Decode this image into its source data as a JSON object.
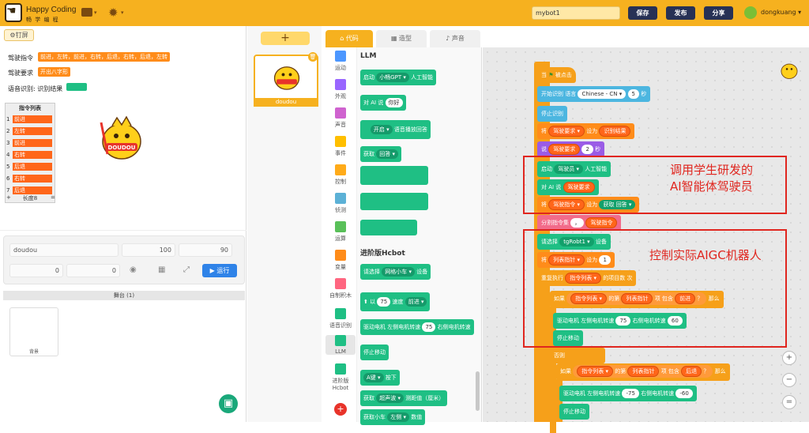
{
  "app": {
    "brand_en": "Happy Coding",
    "brand_cn": "畅 学 编 程",
    "project_name": "mybot1",
    "save": "保存",
    "publish": "发布",
    "share": "分享",
    "username": "dongkuang"
  },
  "left": {
    "pin": "钉屏",
    "vars": [
      {
        "label": "驾驶指令",
        "value": "前进，左转，前进，右转，后退，右转，后退，左转"
      },
      {
        "label": "驾驶要求",
        "value": "开出八字形"
      },
      {
        "label": "语音识别: 识别结果",
        "value": ""
      }
    ],
    "list": {
      "title": "指令列表",
      "items": [
        "前进",
        "左转",
        "前进",
        "右转",
        "后退",
        "右转",
        "后退"
      ],
      "plus": "+",
      "length": "长度8",
      "eq": "="
    },
    "mascot_text": "DOUDOU",
    "sprite": {
      "name": "doudou",
      "x": "100",
      "y": "90",
      "size": "0",
      "direction": "0",
      "run": "运行"
    },
    "backdrop": {
      "title": "舞台",
      "count": "(1)",
      "label": "背景"
    }
  },
  "sprites": {
    "add": "+",
    "card": "doudou"
  },
  "tabs": [
    "代码",
    "造型",
    "声音"
  ],
  "categories": [
    "运动",
    "外观",
    "声音",
    "事件",
    "控制",
    "侦测",
    "运算",
    "变量",
    "自制积木",
    "语音识别",
    "LLM",
    "进阶版Hcbot"
  ],
  "category_colors": [
    "#4c97ff",
    "#9966ff",
    "#cf63cf",
    "#ffbf00",
    "#ffab19",
    "#5cb1d6",
    "#59c059",
    "#ff8c1a",
    "#ff6680",
    "#1fbf84",
    "#1fbf84",
    "#1fbf84"
  ],
  "palette": {
    "llm_title": "LLM",
    "b1": [
      "启动",
      "小畅GPT",
      "人工智能"
    ],
    "b2": [
      "对 AI 说",
      "你好"
    ],
    "b3": [
      "开启",
      "语音播放回答"
    ],
    "b4": [
      "获取",
      "回答"
    ],
    "hcbot_title": "进阶版Hcbot",
    "b5": [
      "请选择",
      "网格小车",
      "设备"
    ],
    "b6": [
      "以",
      "75",
      "速度",
      "前进"
    ],
    "b7": [
      "驱动电机 左侧电机转速",
      "75",
      "右侧电机转速"
    ],
    "b8": "停止移动",
    "b9": [
      "A键",
      "按下"
    ],
    "b10": [
      "获取",
      "超声波",
      "测距值（厘米）"
    ],
    "b11": [
      "获取小车",
      "左侧",
      "数值"
    ]
  },
  "workspace": {
    "hat": [
      "当",
      "被点击"
    ],
    "w1": [
      "开始识别 语言",
      "Chinese - CN",
      "5",
      "秒"
    ],
    "w2": "停止识别",
    "w3": [
      "将",
      "驾驶要求",
      "设为",
      "识别结果"
    ],
    "w4": [
      "说",
      "驾驶要求",
      "2",
      "秒"
    ],
    "w5": [
      "启动",
      "驾驶员",
      "人工智能"
    ],
    "w6": [
      "对 AI 说",
      "驾驶要求"
    ],
    "w7": [
      "将",
      "驾驶指令",
      "设为",
      "获取",
      "回答"
    ],
    "w8": [
      "分割指令集",
      "，",
      "驾驶指令"
    ],
    "w9": [
      "请选择",
      "tgRobt1",
      "设备"
    ],
    "w10": [
      "将",
      "列表指针",
      "设为",
      "1"
    ],
    "w11": [
      "重复执行",
      "指令列表",
      "的项目数",
      "次"
    ],
    "w12": [
      "如果",
      "指令列表",
      "的第",
      "列表指针",
      "项",
      "包含",
      "前进",
      "？",
      "那么"
    ],
    "w13": [
      "驱动电机 左侧电机转速",
      "75",
      "右侧电机转速",
      "60"
    ],
    "w14": "停止移动",
    "w15": "否则",
    "w16": [
      "如果",
      "指令列表",
      "的第",
      "列表指针",
      "项",
      "包含",
      "后退",
      "？",
      "那么"
    ],
    "w17": [
      "驱动电机 左侧电机转速",
      "-75",
      "右侧电机转速",
      "-60"
    ],
    "w18": "停止移动",
    "annot1": "调用学生研发的",
    "annot2": "AI智能体驾驶员",
    "annot3": "控制实际AIGC机器人"
  },
  "zoom": [
    "+",
    "−",
    "="
  ]
}
